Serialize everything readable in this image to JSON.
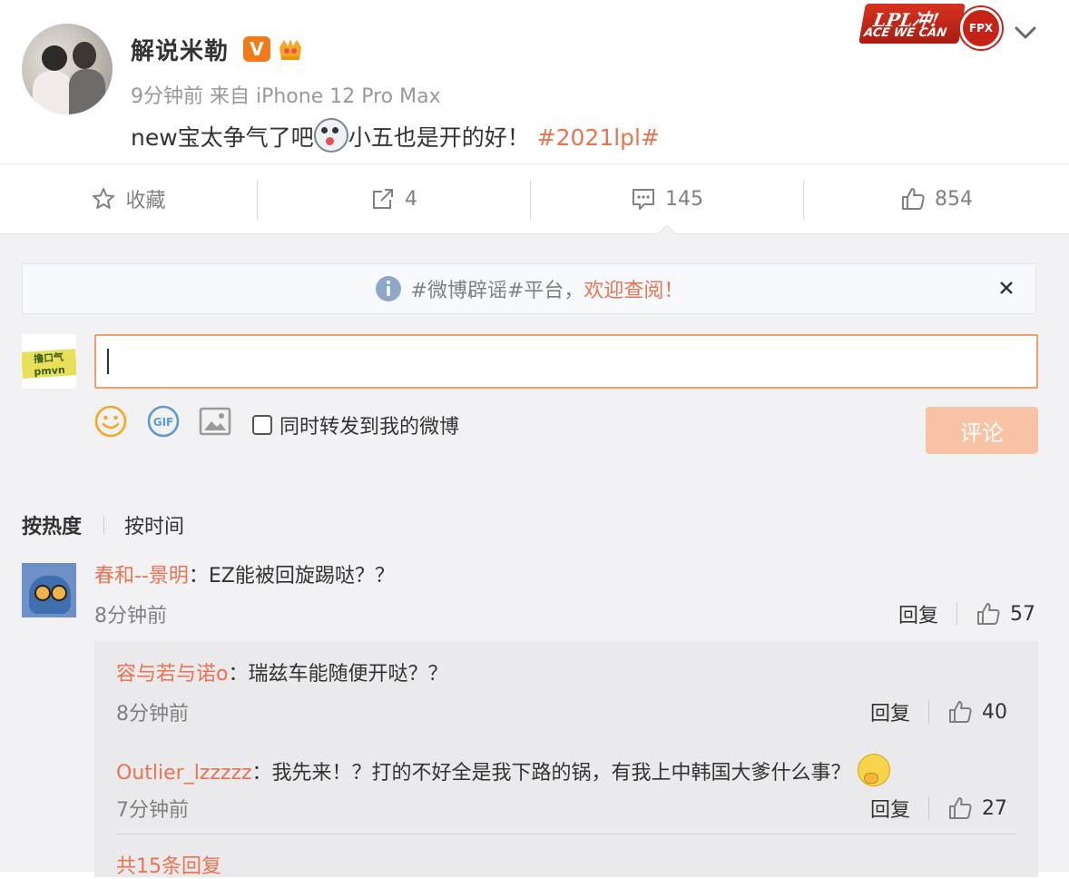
{
  "post": {
    "author": "解说米勒",
    "verified_badge": "V",
    "meta": "9分钟前 来自 iPhone 12 Pro Max",
    "text_before": "new宝太争气了吧",
    "text_after": "小五也是开的好！",
    "hashtag": "#2021lpl#",
    "banner_top": "LPL冲!",
    "banner_bottom": "ACE WE CAN",
    "banner_logo": "FPX"
  },
  "actions": {
    "favorite_label": "收藏",
    "repost_count": "4",
    "comment_count": "145",
    "like_count": "854"
  },
  "notice": {
    "text": "#微博辟谣#平台，",
    "highlight": "欢迎查阅！"
  },
  "composer": {
    "my_avatar_text": "撸口气pmvn",
    "input_value": "",
    "repost_label": "同时转发到我的微博",
    "submit_label": "评论"
  },
  "sort": {
    "hot": "按热度",
    "time": "按时间"
  },
  "comments": [
    {
      "user": "春和--景明",
      "text": "：EZ能被回旋踢哒？？",
      "time": "8分钟前",
      "reply": "回复",
      "likes": "57"
    }
  ],
  "replies": [
    {
      "user": "容与若与诺o",
      "text": "：瑞兹车能随便开哒？？",
      "time": "8分钟前",
      "reply": "回复",
      "likes": "40"
    },
    {
      "user": "Outlier_lzzzzz",
      "text": "：我先来！？打的不好全是我下路的锅，有我上中韩国大爹什么事？",
      "time": "7分钟前",
      "reply": "回复",
      "likes": "27"
    }
  ],
  "more_replies": "共15条回复",
  "colors": {
    "accent": "#eb7350",
    "submit_disabled": "#f8c3a4",
    "panel_bg": "#f2f2f5"
  }
}
